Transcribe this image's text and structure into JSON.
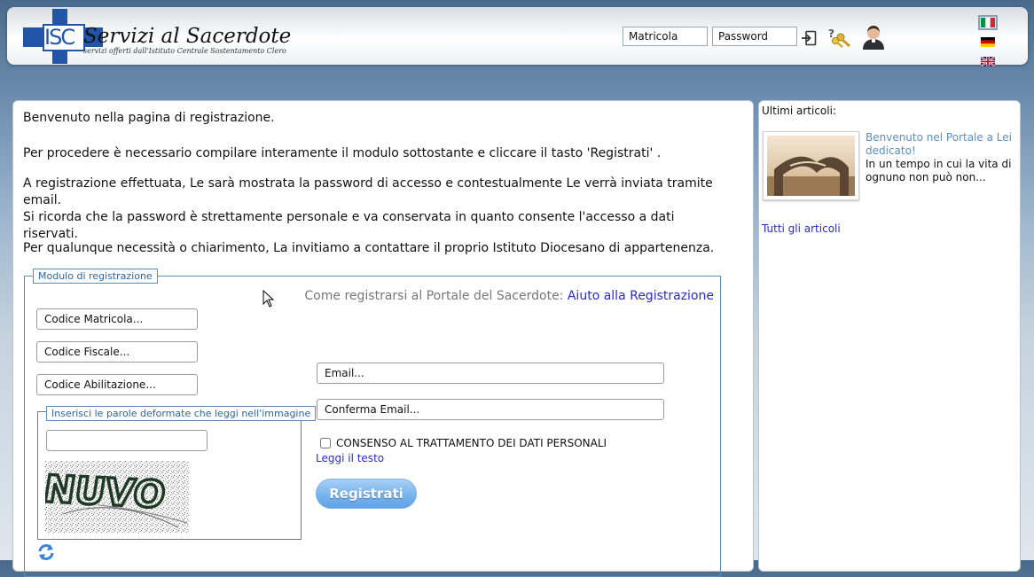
{
  "header": {
    "logo_letters": "ISC",
    "logo_title": "Servizi al Sacerdote",
    "logo_subtitle": "servizi offerti dall'Istituto Centrale Sostentamento Clero",
    "matricola_placeholder": "Matricola",
    "password_placeholder": "Password",
    "icons": [
      "login-icon",
      "help-keys-icon",
      "user-priest-icon"
    ],
    "languages": [
      {
        "code": "it",
        "icon": "flag-italy-icon",
        "selected": true
      },
      {
        "code": "de",
        "icon": "flag-germany-icon",
        "selected": false
      },
      {
        "code": "en",
        "icon": "flag-uk-icon",
        "selected": false
      }
    ]
  },
  "main": {
    "welcome": "Benvenuto nella pagina di registrazione.",
    "instructions": "Per procedere è necessario compilare interamente il modulo sottostante e cliccare il tasto 'Registrati' .",
    "after_registration_1": "A registrazione effettuata, Le sarà mostrata la password di accesso e contestualmente Le verrà inviata tramite email.",
    "after_registration_2": "Si ricorda che la password è strettamente personale e va conservata in quanto consente l'accesso a dati riservati.",
    "contact": "Per qualunque necessità o chiarimento, La invitiamo a contattare il proprio Istituto Diocesano di appartenenza.",
    "form": {
      "legend": "Modulo di registrazione",
      "help_prefix": "Come registrarsi al Portale del Sacerdote:",
      "help_link": "Aiuto alla Registrazione",
      "matricola_placeholder": "Codice Matricola...",
      "fiscale_placeholder": "Codice Fiscale...",
      "abilitazione_placeholder": "Codice Abilitazione...",
      "email_placeholder": "Email...",
      "confirm_email_placeholder": "Conferma Email...",
      "captcha_legend": "Inserisci le parole deformate che leggi nell'immagine",
      "captcha_text": "NUVO",
      "consent_label": "CONSENSO AL TRATTAMENTO DEI DATI PERSONALI",
      "consent_checked": false,
      "read_text_link": "Leggi il testo",
      "submit_label": "Registrati"
    }
  },
  "sidebar": {
    "title": "Ultimi articoli:",
    "articles": [
      {
        "title": "Benvenuto nel Portale a Lei dedicato!",
        "summary": "In un tempo in cui la vita di ognuno non può non..."
      }
    ],
    "all_articles_link": "Tutti gli articoli"
  },
  "colors": {
    "brand_blue": "#2255a8",
    "link_blue": "#2a2ad0",
    "legend_blue": "#2b64a8",
    "button_blue": "#7ab6ee"
  }
}
